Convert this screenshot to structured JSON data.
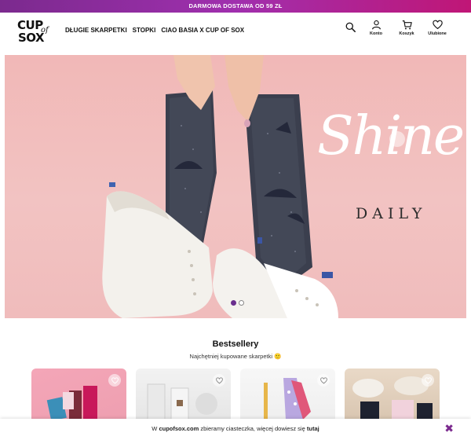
{
  "promo": {
    "text": "DARMOWA DOSTAWA OD 59 ZŁ"
  },
  "logo": {
    "line1": "CUP",
    "line2": "SOX",
    "of": "of"
  },
  "nav": {
    "items": [
      "DŁUGIE SKARPETKI",
      "STOPKI",
      "CIAO BASIA X CUP OF SOX"
    ]
  },
  "header_icons": {
    "search": "search-icon",
    "account": {
      "icon": "user-icon",
      "label": "Konto"
    },
    "cart": {
      "icon": "cart-icon",
      "label": "Koszyk"
    },
    "wishlist": {
      "icon": "heart-icon",
      "label": "Ulubione"
    }
  },
  "hero": {
    "headline": "Shine",
    "subline": "DAILY",
    "slides_total": 2,
    "active_slide": 1
  },
  "bestsellers": {
    "title": "Bestsellery",
    "subtitle": "Najchętniej kupowane skarpetki 🙂"
  },
  "cookie": {
    "prefix": "W",
    "site": "cupofsox.com",
    "middle": "zbieramy ciasteczka, więcej dowiesz się",
    "link": "tutaj",
    "close": "✖"
  },
  "colors": {
    "brand_purple": "#7b2a8e",
    "promo_pink": "#c01676",
    "hero_pink": "#f1b8b7"
  }
}
